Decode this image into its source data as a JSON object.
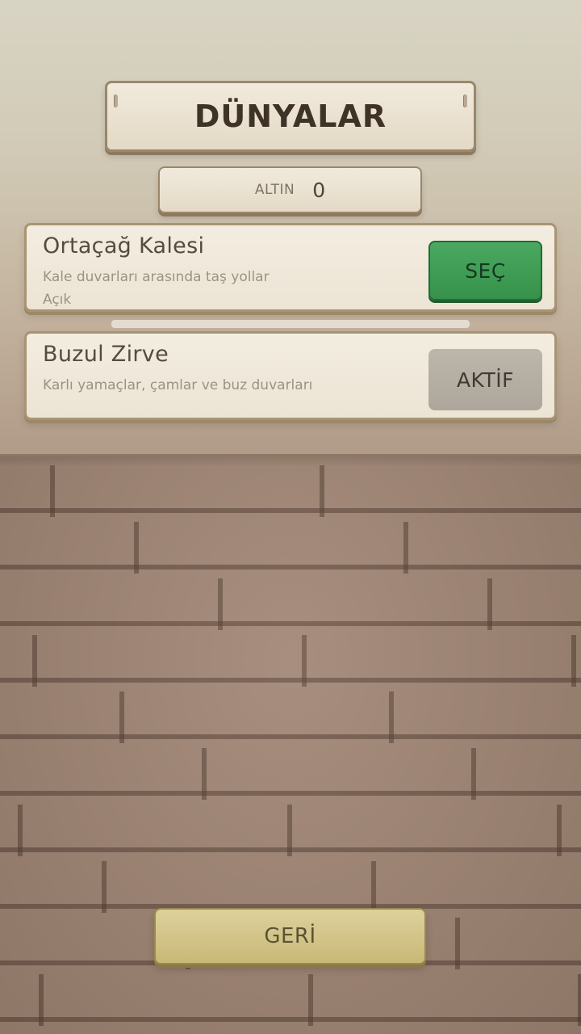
{
  "header": {
    "title": "DÜNYALAR"
  },
  "currency": {
    "label": "ALTIN",
    "value": "0"
  },
  "worlds": [
    {
      "name": "Ortaçağ Kalesi",
      "description": "Kale duvarları arasında taş yollar",
      "status": "Açık",
      "button_label": "SEÇ"
    },
    {
      "name": "Buzul Zirve",
      "description": "Karlı yamaçlar, çamlar ve buz duvarları",
      "button_label": "AKTİF"
    }
  ],
  "footer": {
    "back_label": "GERİ"
  }
}
